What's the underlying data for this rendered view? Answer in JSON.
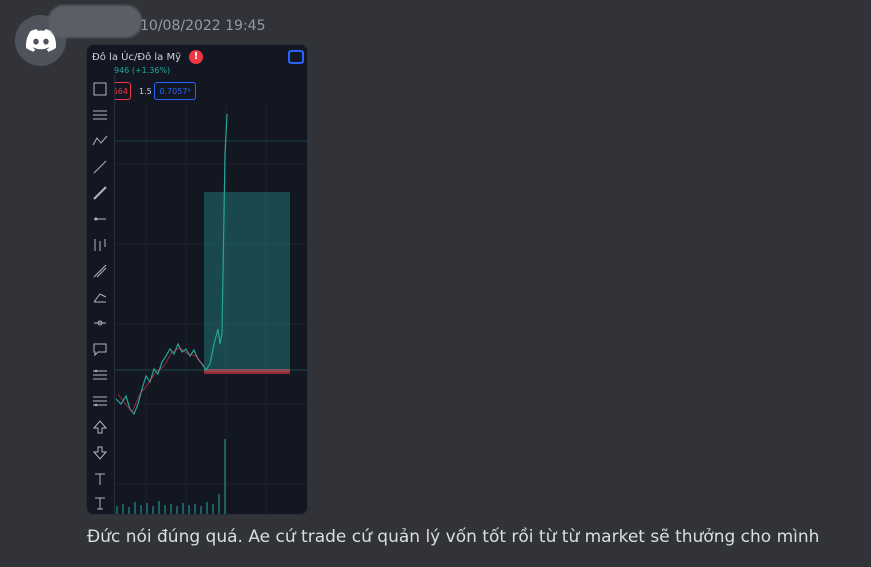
{
  "message": {
    "timestamp": "10/08/2022 19:45",
    "text": "Đức nói đúng quá. Ae cứ trade cứ quản lý vốn tốt rồi từ từ market sẽ thưởng cho mình"
  },
  "attachment": {
    "pair_title": "Đô la Úc/Đô la Mỹ",
    "alert_badge": "!",
    "change_text": "946 (+1.36%)",
    "sell_price": "564",
    "spread": "1.5",
    "buy_price": "0.7057⁹"
  },
  "colors": {
    "background": "#313338",
    "chart_bg": "#131722",
    "up": "#26a69a",
    "down": "#f23645",
    "accent": "#2962ff",
    "discord_blurple": "#ffffff"
  },
  "toolbar_icons": [
    "rectangle-icon",
    "horizontal-lines-icon",
    "zigzag-icon",
    "trend-line-icon",
    "brush-icon",
    "ray-icon",
    "pitchfork-icon",
    "fib-icon",
    "pattern-icon",
    "measure-icon",
    "comment-icon",
    "long-position-icon",
    "short-position-icon",
    "arrow-up-icon",
    "arrow-down-icon",
    "text-icon",
    "anchored-text-icon"
  ]
}
